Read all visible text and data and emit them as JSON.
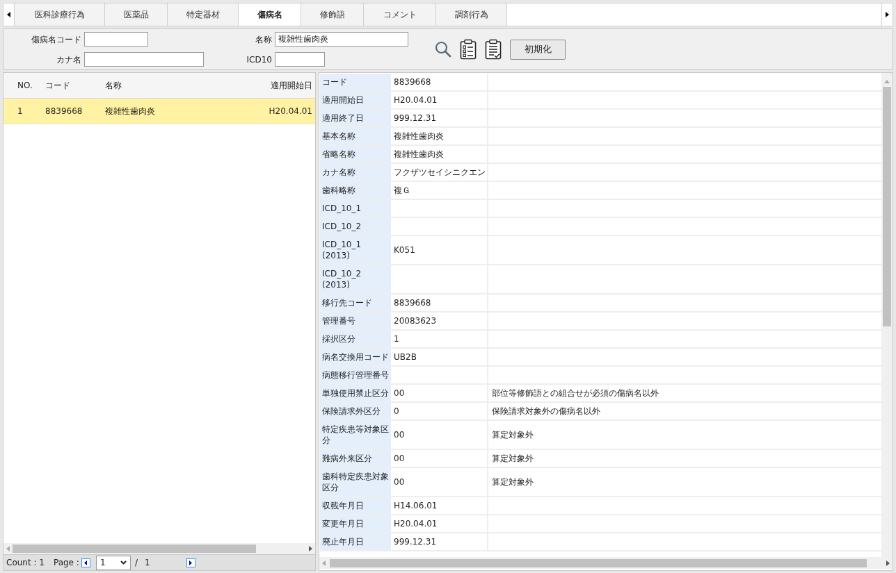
{
  "tabs": [
    {
      "label": "医科診療行為",
      "selected": false
    },
    {
      "label": "医薬品",
      "selected": false
    },
    {
      "label": "特定器材",
      "selected": false
    },
    {
      "label": "傷病名",
      "selected": true
    },
    {
      "label": "修飾語",
      "selected": false
    },
    {
      "label": "コメント",
      "selected": false
    },
    {
      "label": "調剤行為",
      "selected": false
    }
  ],
  "search": {
    "code": {
      "label": "傷病名コード"
    },
    "name": {
      "label": "名称",
      "value": "複雑性歯肉炎"
    },
    "kana": {
      "label": "カナ名"
    },
    "icd10": {
      "label": "ICD10"
    },
    "reset_button": "初期化"
  },
  "list": {
    "columns": [
      "NO.",
      "コード",
      "名称",
      "適用開始日"
    ],
    "rows": [
      {
        "no": "1",
        "code": "8839668",
        "name": "複雑性歯肉炎",
        "start": "H20.04.01",
        "selected": true
      }
    ],
    "footer": {
      "count": "Count : 1",
      "page_label": "Page :",
      "page": "1",
      "separator": "/",
      "total": "1"
    }
  },
  "details": [
    {
      "label": "コード",
      "value": "8839668"
    },
    {
      "label": "適用開始日",
      "value": "H20.04.01"
    },
    {
      "label": "適用終了日",
      "value": "999.12.31"
    },
    {
      "label": "基本名称",
      "value": "複雑性歯肉炎"
    },
    {
      "label": "省略名称",
      "value": "複雑性歯肉炎"
    },
    {
      "label": "カナ名称",
      "value": "フクザツセイシニクエン"
    },
    {
      "label": "歯科略称",
      "value": "複Ｇ"
    },
    {
      "label": "ICD_10_1"
    },
    {
      "label": "ICD_10_2"
    },
    {
      "label": "ICD_10_1 (2013)",
      "value": "K051"
    },
    {
      "label": "ICD_10_2 (2013)"
    },
    {
      "label": "移行先コード",
      "value": "8839668"
    },
    {
      "label": "管理番号",
      "value": "20083623"
    },
    {
      "label": "採択区分",
      "value": "1"
    },
    {
      "label": "病名交換用コード",
      "value": "UB2B"
    },
    {
      "label": "病態移行管理番号"
    },
    {
      "label": "単独使用禁止区分",
      "value": "00",
      "note": "部位等修飾語との組合せが必須の傷病名以外"
    },
    {
      "label": "保険請求外区分",
      "value": "0",
      "note": "保険請求対象外の傷病名以外"
    },
    {
      "label": "特定疾患等対象区分",
      "value": "00",
      "note": "算定対象外"
    },
    {
      "label": "難病外来区分",
      "value": "00",
      "note": "算定対象外"
    },
    {
      "label": "歯科特定疾患対象区分",
      "value": "00",
      "note": "算定対象外"
    },
    {
      "label": "収載年月日",
      "value": "H14.06.01"
    },
    {
      "label": "変更年月日",
      "value": "H20.04.01"
    },
    {
      "label": "廃止年月日",
      "value": "999.12.31"
    }
  ]
}
